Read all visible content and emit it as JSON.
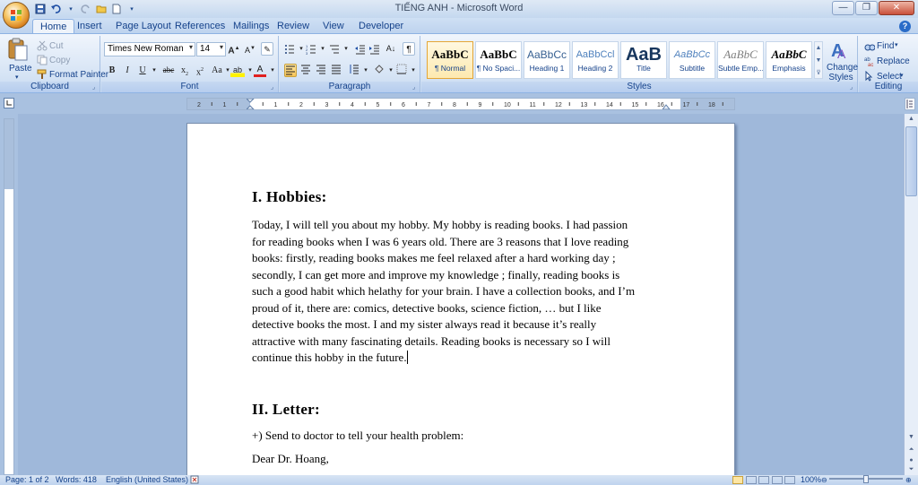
{
  "window": {
    "title": "TIẾNG ANH - Microsoft Word",
    "controls": [
      "minimize",
      "restore",
      "close"
    ]
  },
  "quick_access": [
    "save-icon",
    "undo-icon",
    "redo-icon",
    "open-icon",
    "new-icon",
    "customize-icon"
  ],
  "tabs": [
    {
      "label": "Home",
      "active": true
    },
    {
      "label": "Insert"
    },
    {
      "label": "Page Layout"
    },
    {
      "label": "References"
    },
    {
      "label": "Mailings"
    },
    {
      "label": "Review"
    },
    {
      "label": "View"
    },
    {
      "label": "Developer"
    }
  ],
  "ribbon": {
    "clipboard": {
      "label": "Clipboard",
      "paste": "Paste",
      "cut": "Cut",
      "copy": "Copy",
      "format_painter": "Format Painter"
    },
    "font": {
      "label": "Font",
      "font_name": "Times New Roman",
      "font_size": "14"
    },
    "paragraph": {
      "label": "Paragraph"
    },
    "styles": {
      "label": "Styles",
      "items": [
        {
          "sample": "AaBbC",
          "name": "¶ Normal",
          "selected": true
        },
        {
          "sample": "AaBbC",
          "name": "¶ No Spaci..."
        },
        {
          "sample": "AaBbCc",
          "name": "Heading 1"
        },
        {
          "sample": "AaBbCcl",
          "name": "Heading 2"
        },
        {
          "sample": "AaB",
          "name": "Title"
        },
        {
          "sample": "AaBbCc",
          "name": "Subtitle"
        },
        {
          "sample": "AaBbC",
          "name": "Subtle Emp..."
        },
        {
          "sample": "AaBbC",
          "name": "Emphasis"
        }
      ],
      "change_styles": "Change Styles"
    },
    "editing": {
      "label": "Editing",
      "find": "Find",
      "replace": "Replace",
      "select": "Select"
    }
  },
  "document": {
    "heading1": "I. Hobbies:",
    "paragraph1_lines": [
      "Today, I will tell you about my hobby. My hobby is reading books. I had passion",
      "for reading books when I was 6 years old. There are 3 reasons that I love reading",
      "books: firstly, reading books makes me feel relaxed after a hard working day ;",
      "secondly, I can get more and improve my knowledge ; finally, reading books is",
      "such a good habit which helathy for your brain. I have a collection books, and I’m",
      "proud of it, there are: comics, detective books, science fiction, … but I like",
      "detective books the most. I and my sister always read it because it’s really",
      "attractive with many fascinating details. Reading books is necessary so I will",
      "continue this hobby in the future."
    ],
    "heading2": "II. Letter:",
    "line_send": "+) Send to doctor to tell your health problem:",
    "line_dear": "Dear Dr. Hoang,"
  },
  "status": {
    "page": "Page: 1 of 2",
    "words": "Words: 418",
    "language": "English (United States)",
    "zoom": "100%"
  },
  "colors": {
    "ribbon_text": "#15428b",
    "frame_blue": "#a9c1e0"
  }
}
